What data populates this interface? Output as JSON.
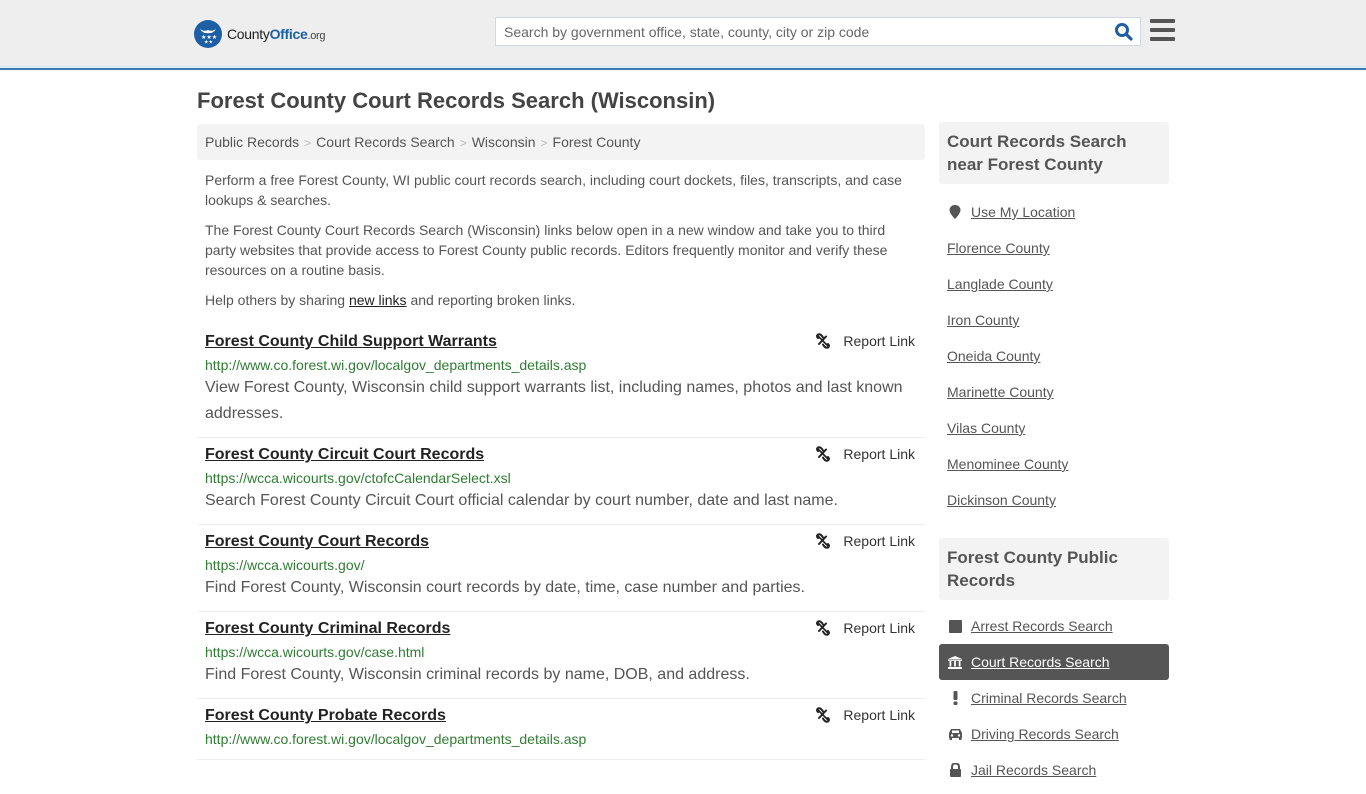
{
  "header": {
    "logo": {
      "name": "County",
      "accent": "Office",
      "tld": ".org"
    },
    "search_placeholder": "Search by government office, state, county, city or zip code",
    "brand_color": "#1d5fa5"
  },
  "page_title": "Forest County Court Records Search (Wisconsin)",
  "breadcrumb": [
    "Public Records",
    "Court Records Search",
    "Wisconsin",
    "Forest County"
  ],
  "intro": {
    "p1": "Perform a free Forest County, WI public court records search, including court dockets, files, transcripts, and case lookups & searches.",
    "p2": "The Forest County Court Records Search (Wisconsin) links below open in a new window and take you to third party websites that provide access to Forest County public records. Editors frequently monitor and verify these resources on a routine basis.",
    "p3_before": "Help others by sharing ",
    "p3_link": "new links",
    "p3_after": " and reporting broken links."
  },
  "report_label": "Report Link",
  "results": [
    {
      "title": "Forest County Child Support Warrants",
      "url": "http://www.co.forest.wi.gov/localgov_departments_details.asp",
      "desc": "View Forest County, Wisconsin child support warrants list, including names, photos and last known addresses."
    },
    {
      "title": "Forest County Circuit Court Records",
      "url": "https://wcca.wicourts.gov/ctofcCalendarSelect.xsl",
      "desc": "Search Forest County Circuit Court official calendar by court number, date and last name."
    },
    {
      "title": "Forest County Court Records",
      "url": "https://wcca.wicourts.gov/",
      "desc": "Find Forest County, Wisconsin court records by date, time, case number and parties."
    },
    {
      "title": "Forest County Criminal Records",
      "url": "https://wcca.wicourts.gov/case.html",
      "desc": "Find Forest County, Wisconsin criminal records by name, DOB, and address."
    },
    {
      "title": "Forest County Probate Records",
      "url": "http://www.co.forest.wi.gov/localgov_departments_details.asp",
      "desc": ""
    }
  ],
  "sidebar": {
    "nearby_title": "Court Records Search near Forest County",
    "use_location": "Use My Location",
    "nearby": [
      "Florence County",
      "Langlade County",
      "Iron County",
      "Oneida County",
      "Marinette County",
      "Vilas County",
      "Menominee County",
      "Dickinson County"
    ],
    "public_title": "Forest County Public Records",
    "public_records": [
      {
        "label": "Arrest Records Search",
        "icon": "square-icon",
        "active": false
      },
      {
        "label": "Court Records Search",
        "icon": "courthouse-icon",
        "active": true
      },
      {
        "label": "Criminal Records Search",
        "icon": "exclamation-icon",
        "active": false
      },
      {
        "label": "Driving Records Search",
        "icon": "car-icon",
        "active": false
      },
      {
        "label": "Jail Records Search",
        "icon": "lock-icon",
        "active": false
      }
    ]
  }
}
